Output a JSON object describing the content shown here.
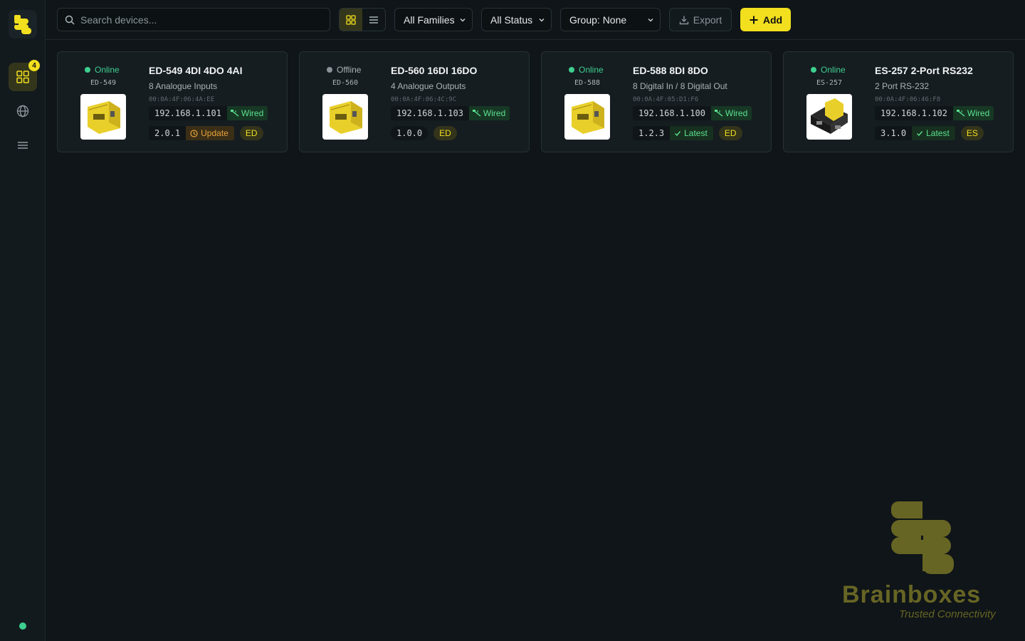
{
  "sidebar": {
    "devices_badge": "4",
    "items": [
      {
        "icon": "grid-icon"
      },
      {
        "icon": "globe-icon"
      },
      {
        "icon": "menu-icon"
      }
    ],
    "connection_color": "#3ecf8e"
  },
  "toolbar": {
    "search_placeholder": "Search devices...",
    "view_modes": [
      "grid",
      "list"
    ],
    "active_view": "grid",
    "family_filter": "All Families",
    "status_filter": "All Status",
    "group_filter": "Group: None",
    "export_label": "Export",
    "add_label": "Add"
  },
  "devices": [
    {
      "status": "Online",
      "status_color": "#3ecf8e",
      "code": "ED-549",
      "name": "ED-549 4DI 4DO 4AI",
      "description": "8 Analogue Inputs",
      "mac": "00:0A:4F:06:4A:EE",
      "ip": "192.168.1.101",
      "connection": "Wired",
      "version": "2.0.1",
      "update_status": "Update",
      "family": "ED"
    },
    {
      "status": "Offline",
      "status_color": "#8b9599",
      "code": "ED-560",
      "name": "ED-560 16DI 16DO",
      "description": "4 Analogue Outputs",
      "mac": "00:0A:4F:06:4C:9C",
      "ip": "192.168.1.103",
      "connection": "Wired",
      "version": "1.0.0",
      "update_status": "",
      "family": "ED"
    },
    {
      "status": "Online",
      "status_color": "#3ecf8e",
      "code": "ED-588",
      "name": "ED-588 8DI 8DO",
      "description": "8 Digital In / 8 Digital Out",
      "mac": "00:0A:4F:05:D1:F6",
      "ip": "192.168.1.100",
      "connection": "Wired",
      "version": "1.2.3",
      "update_status": "Latest",
      "family": "ED"
    },
    {
      "status": "Online",
      "status_color": "#3ecf8e",
      "code": "ES-257",
      "name": "ES-257 2-Port RS232",
      "description": "2 Port RS-232",
      "mac": "00:0A:4F:06:46:F8",
      "ip": "192.168.1.102",
      "connection": "Wired",
      "version": "3.1.0",
      "update_status": "Latest",
      "family": "ES"
    }
  ],
  "brand": {
    "name": "Brainboxes",
    "tagline": "Trusted Connectivity",
    "color": "#676524"
  }
}
